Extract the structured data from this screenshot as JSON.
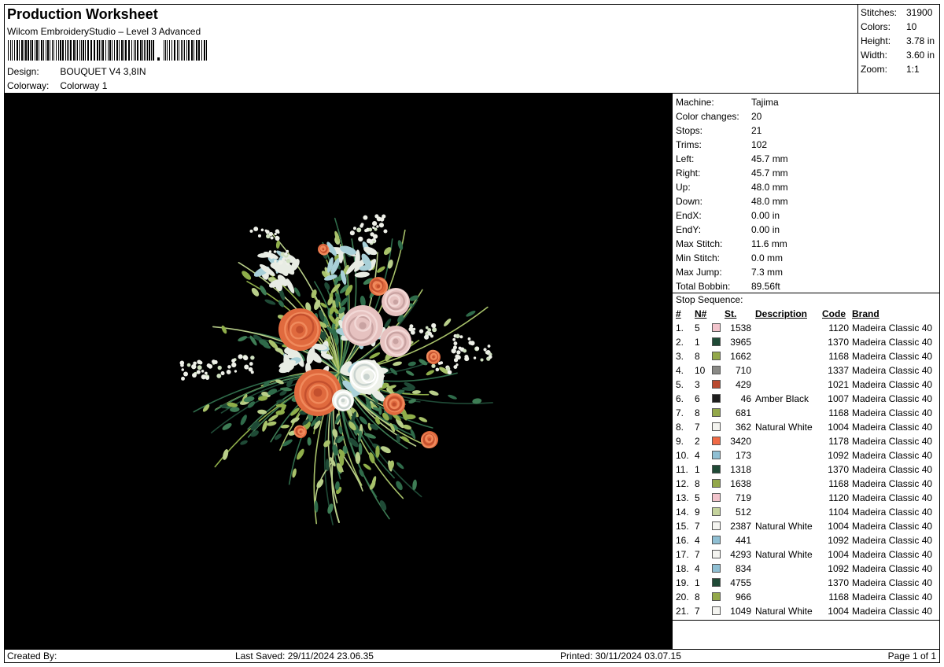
{
  "header": {
    "title": "Production Worksheet",
    "software": "Wilcom EmbroideryStudio – Level 3 Advanced",
    "design_label": "Design:",
    "design_value": "BOUQUET V4 3,8IN",
    "colorway_label": "Colorway:",
    "colorway_value": "Colorway 1"
  },
  "stats": [
    {
      "label": "Stitches:",
      "value": "31900"
    },
    {
      "label": "Colors:",
      "value": "10"
    },
    {
      "label": "Height:",
      "value": "3.78 in"
    },
    {
      "label": "Width:",
      "value": "3.60 in"
    },
    {
      "label": "Zoom:",
      "value": "1:1"
    }
  ],
  "machine": [
    {
      "label": "Machine:",
      "value": "Tajima"
    },
    {
      "label": "Color changes:",
      "value": "20"
    },
    {
      "label": "Stops:",
      "value": "21"
    },
    {
      "label": "Trims:",
      "value": "102"
    },
    {
      "label": "Left:",
      "value": "45.7 mm"
    },
    {
      "label": "Right:",
      "value": "45.7 mm"
    },
    {
      "label": "Up:",
      "value": "48.0 mm"
    },
    {
      "label": "Down:",
      "value": "48.0 mm"
    },
    {
      "label": "EndX:",
      "value": "0.00 in"
    },
    {
      "label": "EndY:",
      "value": "0.00 in"
    },
    {
      "label": "Max Stitch:",
      "value": "11.6 mm"
    },
    {
      "label": "Min Stitch:",
      "value": "0.0 mm"
    },
    {
      "label": "Max Jump:",
      "value": "7.3 mm"
    },
    {
      "label": "Total Bobbin:",
      "value": "89.56ft"
    }
  ],
  "stop_sequence": {
    "caption": "Stop Sequence:",
    "headers": {
      "index": "#",
      "needle": "N#",
      "stitches": "St.",
      "description": "Description",
      "code": "Code",
      "brand": "Brand"
    },
    "rows": [
      {
        "index": "1.",
        "needle": "5",
        "color": "#f2c4cc",
        "stitches": "1538",
        "description": "",
        "code": "1120",
        "brand": "Madeira Classic 40"
      },
      {
        "index": "2.",
        "needle": "1",
        "color": "#1f4a36",
        "stitches": "3965",
        "description": "",
        "code": "1370",
        "brand": "Madeira Classic 40"
      },
      {
        "index": "3.",
        "needle": "8",
        "color": "#93a84a",
        "stitches": "1662",
        "description": "",
        "code": "1168",
        "brand": "Madeira Classic 40"
      },
      {
        "index": "4.",
        "needle": "10",
        "color": "#8a8a86",
        "stitches": "710",
        "description": "",
        "code": "1337",
        "brand": "Madeira Classic 40"
      },
      {
        "index": "5.",
        "needle": "3",
        "color": "#b94a30",
        "stitches": "429",
        "description": "",
        "code": "1021",
        "brand": "Madeira Classic 40"
      },
      {
        "index": "6.",
        "needle": "6",
        "color": "#1e1e1e",
        "stitches": "46",
        "description": "Amber Black",
        "code": "1007",
        "brand": "Madeira Classic 40"
      },
      {
        "index": "7.",
        "needle": "8",
        "color": "#93a84a",
        "stitches": "681",
        "description": "",
        "code": "1168",
        "brand": "Madeira Classic 40"
      },
      {
        "index": "8.",
        "needle": "7",
        "color": "#f4f4f0",
        "stitches": "362",
        "description": "Natural White",
        "code": "1004",
        "brand": "Madeira Classic 40"
      },
      {
        "index": "9.",
        "needle": "2",
        "color": "#f06a45",
        "stitches": "3420",
        "description": "",
        "code": "1178",
        "brand": "Madeira Classic 40"
      },
      {
        "index": "10.",
        "needle": "4",
        "color": "#8fbfd3",
        "stitches": "173",
        "description": "",
        "code": "1092",
        "brand": "Madeira Classic 40"
      },
      {
        "index": "11.",
        "needle": "1",
        "color": "#1f4a36",
        "stitches": "1318",
        "description": "",
        "code": "1370",
        "brand": "Madeira Classic 40"
      },
      {
        "index": "12.",
        "needle": "8",
        "color": "#93a84a",
        "stitches": "1638",
        "description": "",
        "code": "1168",
        "brand": "Madeira Classic 40"
      },
      {
        "index": "13.",
        "needle": "5",
        "color": "#f2c4cc",
        "stitches": "719",
        "description": "",
        "code": "1120",
        "brand": "Madeira Classic 40"
      },
      {
        "index": "14.",
        "needle": "9",
        "color": "#c5d39d",
        "stitches": "512",
        "description": "",
        "code": "1104",
        "brand": "Madeira Classic 40"
      },
      {
        "index": "15.",
        "needle": "7",
        "color": "#f4f4f0",
        "stitches": "2387",
        "description": "Natural White",
        "code": "1004",
        "brand": "Madeira Classic 40"
      },
      {
        "index": "16.",
        "needle": "4",
        "color": "#8fbfd3",
        "stitches": "441",
        "description": "",
        "code": "1092",
        "brand": "Madeira Classic 40"
      },
      {
        "index": "17.",
        "needle": "7",
        "color": "#f4f4f0",
        "stitches": "4293",
        "description": "Natural White",
        "code": "1004",
        "brand": "Madeira Classic 40"
      },
      {
        "index": "18.",
        "needle": "4",
        "color": "#8fbfd3",
        "stitches": "834",
        "description": "",
        "code": "1092",
        "brand": "Madeira Classic 40"
      },
      {
        "index": "19.",
        "needle": "1",
        "color": "#1f4a36",
        "stitches": "4755",
        "description": "",
        "code": "1370",
        "brand": "Madeira Classic 40"
      },
      {
        "index": "20.",
        "needle": "8",
        "color": "#93a84a",
        "stitches": "966",
        "description": "",
        "code": "1168",
        "brand": "Madeira Classic 40"
      },
      {
        "index": "21.",
        "needle": "7",
        "color": "#f4f4f0",
        "stitches": "1049",
        "description": "Natural White",
        "code": "1004",
        "brand": "Madeira Classic 40"
      }
    ]
  },
  "footer": {
    "created_by": "Created By:",
    "last_saved": "Last Saved: 29/11/2024 23.06.35",
    "printed": "Printed: 30/11/2024 03.07.15",
    "page": "Page 1 of 1"
  }
}
